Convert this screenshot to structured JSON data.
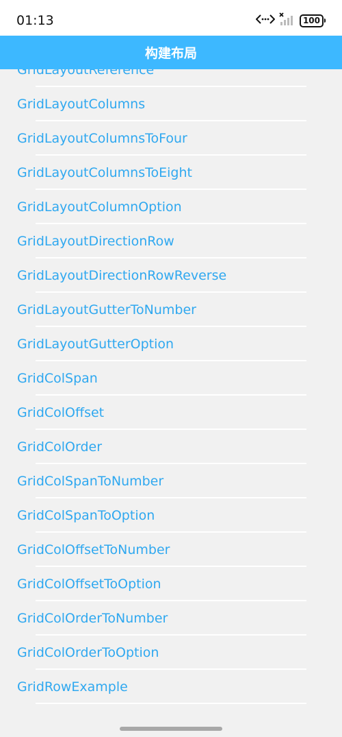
{
  "status_bar": {
    "time": "01:13",
    "battery": "100",
    "icons": [
      "data-transfer-icon",
      "no-sim-icon",
      "signal-icon",
      "battery-icon"
    ]
  },
  "header": {
    "title": "构建布局",
    "background_color": "#3db8ff"
  },
  "list": {
    "text_color": "#2fa8f0",
    "items": [
      "GridLayoutReference",
      "GridLayoutColumns",
      "GridLayoutColumnsToFour",
      "GridLayoutColumnsToEight",
      "GridLayoutColumnOption",
      "GridLayoutDirectionRow",
      "GridLayoutDirectionRowReverse",
      "GridLayoutGutterToNumber",
      "GridLayoutGutterOption",
      "GridColSpan",
      "GridColOffset",
      "GridColOrder",
      "GridColSpanToNumber",
      "GridColSpanToOption",
      "GridColOffsetToNumber",
      "GridColOffsetToOption",
      "GridColOrderToNumber",
      "GridColOrderToOption",
      "GridRowExample"
    ]
  }
}
